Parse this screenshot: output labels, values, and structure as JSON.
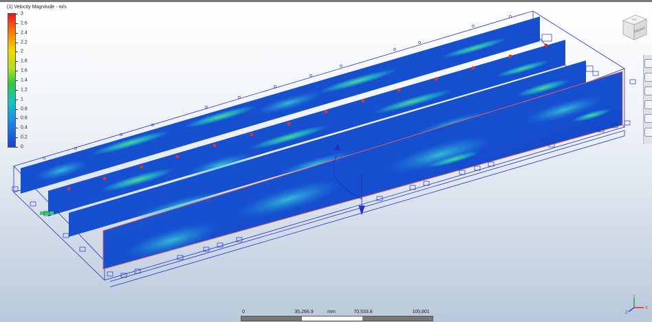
{
  "legend": {
    "title": "(1) Velocity Magnitude - m/s",
    "ticks": [
      "3",
      "2.6",
      "2.4",
      "2.2",
      "2",
      "1.8",
      "1.6",
      "1.4",
      "1.2",
      "1",
      "0.8",
      "0.6",
      "0.4",
      "0.2",
      "0"
    ]
  },
  "viewcube": {
    "top_label": "TOP",
    "front_label": "FRONT"
  },
  "triad": {
    "x_label": "X",
    "y_label": "Y",
    "z_label": "Z"
  },
  "scalebar": {
    "label_0": "0",
    "label_1": "35,266.9",
    "unit": "mm",
    "label_2": "70,533.8",
    "label_3": "105,801"
  },
  "toolbar": {
    "icons": [
      "navigation-icon",
      "pan-icon",
      "zoom-icon",
      "rotate-icon",
      "settings-icon",
      "fit-icon"
    ]
  },
  "colors": {
    "high": "#e31a1c",
    "mid": "#2ecc40",
    "low": "#1a3fd8",
    "wireframe": "#1f2fc9",
    "selection_edge": "#e0605a"
  }
}
